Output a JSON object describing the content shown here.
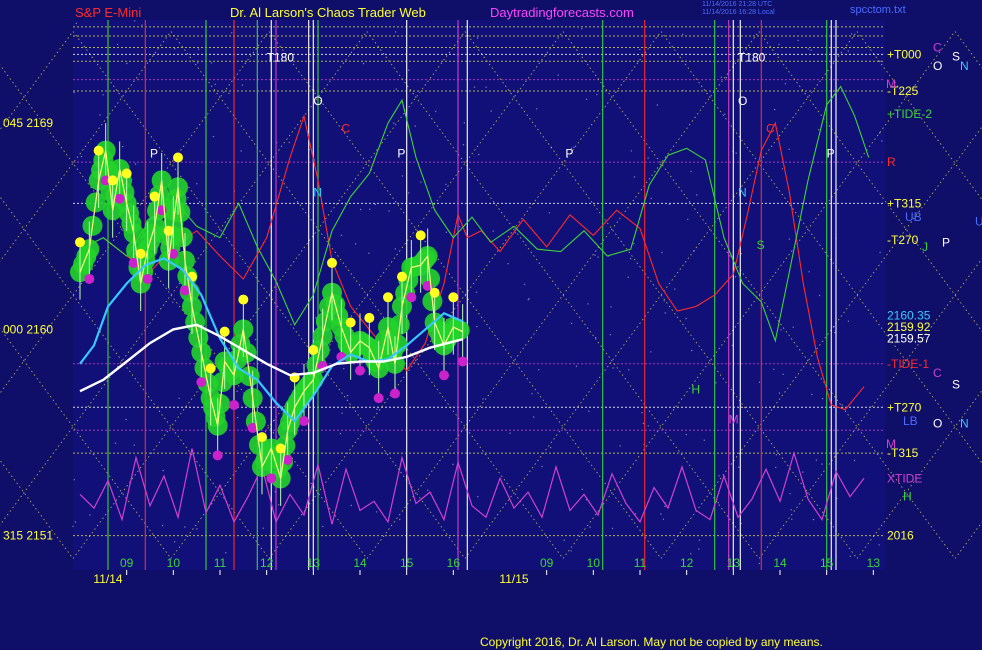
{
  "header": {
    "symbol": "S&P E-Mini",
    "site": "Dr. Al Larson's Chaos Trader Web",
    "url": "Daytradingforecasts.com",
    "utc_line1": "11/14/2016 21:28 UTC",
    "utc_line2": "11/14/2016 16:28 Local",
    "file": "spcctom.txt"
  },
  "footer": {
    "copyright": "Copyright 2016, Dr. Al Larson. May not be copied by any means."
  },
  "colors": {
    "background": "#0f0f6a",
    "grid_yellow": "#d8d84a",
    "price_green": "#22d42a",
    "price_yellow": "#ffff20",
    "price_magenta": "#cc22cc",
    "ma_cyan": "#38c8ff",
    "ma_white": "#ffffff",
    "forecast_red": "#ff2a2a",
    "forecast_green": "#3bd43b",
    "xtide_magenta": "#d040d0"
  },
  "chart_data": {
    "type": "line",
    "title": "S&P E-Mini",
    "y_axis_left": [
      {
        "label": "045  2169",
        "value": 2169
      },
      {
        "label": "000  2160",
        "value": 2160
      },
      {
        "label": "315  2151",
        "value": 2151
      }
    ],
    "ylim": [
      2149.5,
      2173.5
    ],
    "x_hour_labels": [
      {
        "label": "09",
        "h": 9
      },
      {
        "label": "10",
        "h": 10
      },
      {
        "label": "11",
        "h": 11
      },
      {
        "label": "12",
        "h": 12
      },
      {
        "label": "13",
        "h": 13
      },
      {
        "label": "14",
        "h": 14
      },
      {
        "label": "15",
        "h": 15
      },
      {
        "label": "16",
        "h": 16
      },
      {
        "label": "09",
        "h": 18
      },
      {
        "label": "10",
        "h": 19
      },
      {
        "label": "11",
        "h": 20
      },
      {
        "label": "12",
        "h": 21
      },
      {
        "label": "13",
        "h": 22
      },
      {
        "label": "14",
        "h": 23
      },
      {
        "label": "15",
        "h": 24
      },
      {
        "label": "13",
        "h": 25
      }
    ],
    "x_dates": [
      {
        "label": "11/14",
        "h": 8.6
      },
      {
        "label": "11/15",
        "h": 17.3
      }
    ],
    "right_labels": [
      {
        "label": "+T000",
        "value": 2172.0,
        "color": "#ffff40"
      },
      {
        "label": "-T225",
        "value": 2170.4,
        "color": "#ffff40"
      },
      {
        "label": "+TIDE-2",
        "value": 2169.4,
        "color": "#3bd43b"
      },
      {
        "label": "R",
        "value": 2167.3,
        "color": "#ff2a2a"
      },
      {
        "label": "+T315",
        "value": 2165.5,
        "color": "#ffff40"
      },
      {
        "label": "-T270",
        "value": 2163.9,
        "color": "#ffff40"
      },
      {
        "label": "2160.35",
        "value": 2160.6,
        "color": "#38c8ff"
      },
      {
        "label": "2159.92",
        "value": 2160.1,
        "color": "#ffff40"
      },
      {
        "label": "2159.57",
        "value": 2159.6,
        "color": "#ffffff"
      },
      {
        "label": "-TIDE-1",
        "value": 2158.5,
        "color": "#ff2a2a"
      },
      {
        "label": "+T270",
        "value": 2156.6,
        "color": "#ffff40"
      },
      {
        "label": "-T315",
        "value": 2154.6,
        "color": "#ffff40"
      },
      {
        "label": "XTIDE",
        "value": 2153.5,
        "color": "#d040d0"
      },
      {
        "label": "2016",
        "value": 2151.0,
        "color": "#ffff40"
      }
    ],
    "price_path": [
      [
        8.0,
        2162.5
      ],
      [
        8.2,
        2163.5
      ],
      [
        8.4,
        2166.5
      ],
      [
        8.55,
        2167.8
      ],
      [
        8.7,
        2165.2
      ],
      [
        8.85,
        2167.0
      ],
      [
        9.0,
        2165.5
      ],
      [
        9.15,
        2164.2
      ],
      [
        9.3,
        2162.0
      ],
      [
        9.45,
        2163.5
      ],
      [
        9.6,
        2164.5
      ],
      [
        9.75,
        2166.5
      ],
      [
        9.9,
        2163.0
      ],
      [
        10.0,
        2164.6
      ],
      [
        10.1,
        2166.2
      ],
      [
        10.25,
        2163.0
      ],
      [
        10.4,
        2161.0
      ],
      [
        10.6,
        2159.0
      ],
      [
        10.8,
        2157.0
      ],
      [
        10.95,
        2155.8
      ],
      [
        11.1,
        2158.6
      ],
      [
        11.3,
        2158.0
      ],
      [
        11.5,
        2160.0
      ],
      [
        11.7,
        2157.0
      ],
      [
        11.9,
        2154.0
      ],
      [
        12.1,
        2154.8
      ],
      [
        12.3,
        2153.5
      ],
      [
        12.45,
        2155.6
      ],
      [
        12.6,
        2156.6
      ],
      [
        12.8,
        2157.3
      ],
      [
        13.0,
        2157.8
      ],
      [
        13.2,
        2159.7
      ],
      [
        13.4,
        2161.6
      ],
      [
        13.6,
        2160.1
      ],
      [
        13.8,
        2159.0
      ],
      [
        14.0,
        2159.5
      ],
      [
        14.2,
        2159.2
      ],
      [
        14.4,
        2158.3
      ],
      [
        14.6,
        2160.1
      ],
      [
        14.75,
        2158.5
      ],
      [
        14.9,
        2161.0
      ],
      [
        15.1,
        2162.7
      ],
      [
        15.3,
        2162.8
      ],
      [
        15.45,
        2163.2
      ],
      [
        15.6,
        2160.3
      ],
      [
        15.8,
        2159.3
      ],
      [
        16.0,
        2160.1
      ],
      [
        16.2,
        2159.9
      ]
    ],
    "ma_cyan": [
      [
        8.0,
        2158.5
      ],
      [
        8.3,
        2159.3
      ],
      [
        8.6,
        2161.0
      ],
      [
        9.0,
        2162.0
      ],
      [
        9.4,
        2162.8
      ],
      [
        9.8,
        2163.1
      ],
      [
        10.2,
        2162.6
      ],
      [
        10.6,
        2161.5
      ],
      [
        11.0,
        2159.6
      ],
      [
        11.4,
        2158.3
      ],
      [
        11.8,
        2157.8
      ],
      [
        12.2,
        2156.8
      ],
      [
        12.6,
        2156.0
      ],
      [
        13.0,
        2157.1
      ],
      [
        13.4,
        2158.4
      ],
      [
        13.8,
        2158.9
      ],
      [
        14.2,
        2158.6
      ],
      [
        14.6,
        2158.7
      ],
      [
        15.0,
        2159.3
      ],
      [
        15.4,
        2160.0
      ],
      [
        15.8,
        2160.7
      ],
      [
        16.2,
        2160.35
      ]
    ],
    "ma_white": [
      [
        8.0,
        2157.3
      ],
      [
        8.5,
        2157.8
      ],
      [
        9.0,
        2158.6
      ],
      [
        9.5,
        2159.4
      ],
      [
        10.0,
        2160.0
      ],
      [
        10.5,
        2160.2
      ],
      [
        11.0,
        2159.7
      ],
      [
        11.5,
        2159.1
      ],
      [
        12.0,
        2158.5
      ],
      [
        12.5,
        2158.0
      ],
      [
        13.0,
        2158.1
      ],
      [
        13.5,
        2158.5
      ],
      [
        14.0,
        2158.6
      ],
      [
        14.5,
        2158.6
      ],
      [
        15.0,
        2158.8
      ],
      [
        15.5,
        2159.2
      ],
      [
        16.2,
        2159.57
      ]
    ],
    "forecast_red": [
      [
        8.5,
        2164.0
      ],
      [
        9.0,
        2163.2
      ],
      [
        9.5,
        2162.5
      ],
      [
        10.0,
        2163.6
      ],
      [
        10.5,
        2164.3
      ],
      [
        11.0,
        2163.2
      ],
      [
        11.5,
        2162.2
      ],
      [
        12.0,
        2164.0
      ],
      [
        12.5,
        2167.5
      ],
      [
        12.8,
        2169.3
      ],
      [
        13.1,
        2166.5
      ],
      [
        13.4,
        2163.0
      ],
      [
        13.8,
        2161.0
      ],
      [
        14.2,
        2160.0
      ],
      [
        14.6,
        2159.0
      ],
      [
        15.0,
        2158.2
      ],
      [
        15.4,
        2159.4
      ],
      [
        15.8,
        2162.0
      ],
      [
        16.1,
        2165.0
      ],
      [
        16.3,
        2164.0
      ],
      [
        16.6,
        2164.3
      ],
      [
        17.0,
        2163.4
      ],
      [
        17.5,
        2164.8
      ],
      [
        18.0,
        2163.6
      ],
      [
        18.5,
        2165.0
      ],
      [
        19.0,
        2164.1
      ],
      [
        19.5,
        2165.2
      ],
      [
        20.0,
        2164.4
      ],
      [
        20.4,
        2162.0
      ],
      [
        20.8,
        2160.8
      ],
      [
        21.2,
        2161.0
      ],
      [
        21.6,
        2161.5
      ],
      [
        22.0,
        2162.4
      ],
      [
        22.3,
        2165.0
      ],
      [
        22.6,
        2167.8
      ],
      [
        22.9,
        2169.0
      ],
      [
        23.2,
        2166.0
      ],
      [
        23.5,
        2162.0
      ],
      [
        23.8,
        2158.8
      ],
      [
        24.1,
        2156.7
      ],
      [
        24.4,
        2156.5
      ],
      [
        24.8,
        2157.5
      ]
    ],
    "forecast_green": [
      [
        8.0,
        2163.5
      ],
      [
        8.5,
        2164.0
      ],
      [
        9.0,
        2163.2
      ],
      [
        9.5,
        2164.8
      ],
      [
        10.0,
        2165.7
      ],
      [
        10.5,
        2164.5
      ],
      [
        11.0,
        2164.0
      ],
      [
        11.4,
        2165.5
      ],
      [
        11.8,
        2163.6
      ],
      [
        12.2,
        2162.1
      ],
      [
        12.6,
        2160.2
      ],
      [
        13.0,
        2161.5
      ],
      [
        13.4,
        2164.3
      ],
      [
        13.8,
        2165.8
      ],
      [
        14.2,
        2166.8
      ],
      [
        14.6,
        2169.0
      ],
      [
        14.9,
        2170.0
      ],
      [
        15.2,
        2167.5
      ],
      [
        15.6,
        2165.2
      ],
      [
        16.0,
        2164.0
      ],
      [
        16.4,
        2164.9
      ],
      [
        16.8,
        2163.8
      ],
      [
        17.3,
        2164.5
      ],
      [
        17.8,
        2163.5
      ],
      [
        18.3,
        2163.4
      ],
      [
        18.8,
        2164.3
      ],
      [
        19.3,
        2163.2
      ],
      [
        19.8,
        2163.5
      ],
      [
        20.2,
        2166.3
      ],
      [
        20.6,
        2167.6
      ],
      [
        21.0,
        2167.9
      ],
      [
        21.4,
        2167.4
      ],
      [
        21.8,
        2164.0
      ],
      [
        22.2,
        2162.0
      ],
      [
        22.6,
        2161.2
      ],
      [
        22.9,
        2159.5
      ],
      [
        23.2,
        2162.5
      ],
      [
        23.6,
        2166.5
      ],
      [
        24.0,
        2169.8
      ],
      [
        24.3,
        2170.6
      ],
      [
        24.6,
        2169.3
      ],
      [
        24.9,
        2167.5
      ]
    ],
    "xtide_magenta": [
      [
        8.0,
        2152.8
      ],
      [
        8.3,
        2152.2
      ],
      [
        8.6,
        2153.4
      ],
      [
        8.9,
        2151.7
      ],
      [
        9.2,
        2154.4
      ],
      [
        9.5,
        2152.3
      ],
      [
        9.8,
        2153.6
      ],
      [
        10.1,
        2151.8
      ],
      [
        10.4,
        2154.8
      ],
      [
        10.7,
        2152.0
      ],
      [
        11.0,
        2153.2
      ],
      [
        11.3,
        2151.6
      ],
      [
        11.6,
        2152.7
      ],
      [
        11.9,
        2154.0
      ],
      [
        12.2,
        2151.6
      ],
      [
        12.5,
        2152.8
      ],
      [
        12.8,
        2151.9
      ],
      [
        13.1,
        2154.1
      ],
      [
        13.4,
        2151.5
      ],
      [
        13.7,
        2153.9
      ],
      [
        14.0,
        2152.1
      ],
      [
        14.3,
        2152.5
      ],
      [
        14.6,
        2151.6
      ],
      [
        14.9,
        2154.4
      ],
      [
        15.2,
        2152.4
      ],
      [
        15.5,
        2152.9
      ],
      [
        15.8,
        2151.7
      ],
      [
        16.1,
        2154.2
      ],
      [
        16.4,
        2152.3
      ],
      [
        16.7,
        2151.8
      ],
      [
        17.0,
        2153.5
      ],
      [
        17.3,
        2152.2
      ],
      [
        17.6,
        2152.9
      ],
      [
        17.9,
        2151.8
      ],
      [
        18.2,
        2154.0
      ],
      [
        18.5,
        2152.1
      ],
      [
        18.8,
        2152.8
      ],
      [
        19.1,
        2151.9
      ],
      [
        19.4,
        2153.7
      ],
      [
        19.7,
        2152.4
      ],
      [
        20.0,
        2151.6
      ],
      [
        20.3,
        2153.1
      ],
      [
        20.6,
        2152.2
      ],
      [
        20.9,
        2154.0
      ],
      [
        21.2,
        2152.1
      ],
      [
        21.5,
        2151.7
      ],
      [
        21.8,
        2153.6
      ],
      [
        22.1,
        2151.8
      ],
      [
        22.4,
        2152.6
      ],
      [
        22.7,
        2153.9
      ],
      [
        23.0,
        2152.5
      ],
      [
        23.3,
        2154.6
      ],
      [
        23.6,
        2152.6
      ],
      [
        23.9,
        2151.7
      ],
      [
        24.2,
        2153.8
      ],
      [
        24.5,
        2152.7
      ],
      [
        24.8,
        2153.5
      ]
    ],
    "vertical_markers": [
      {
        "h": 8.6,
        "color": "#3bd43b"
      },
      {
        "h": 9.4,
        "color": "#ff2a2a"
      },
      {
        "h": 10.7,
        "color": "#3bd43b"
      },
      {
        "h": 11.3,
        "color": "#ff2a2a"
      },
      {
        "h": 11.8,
        "color": "#3bd43b"
      },
      {
        "h": 12.1,
        "color": "#ffffff"
      },
      {
        "h": 12.2,
        "color": "#d040d0"
      },
      {
        "h": 12.9,
        "color": "#ffffff"
      },
      {
        "h": 13.0,
        "color": "#ffffff"
      },
      {
        "h": 13.1,
        "color": "#3bd43b"
      },
      {
        "h": 15.0,
        "color": "#ffffff"
      },
      {
        "h": 16.1,
        "color": "#d040d0"
      },
      {
        "h": 16.3,
        "color": "#ffffff"
      },
      {
        "h": 19.2,
        "color": "#3bd43b"
      },
      {
        "h": 20.1,
        "color": "#ff2a2a"
      },
      {
        "h": 21.6,
        "color": "#3bd43b"
      },
      {
        "h": 21.9,
        "color": "#d040d0"
      },
      {
        "h": 22.0,
        "color": "#ffffff"
      },
      {
        "h": 22.15,
        "color": "#ffffff"
      },
      {
        "h": 22.6,
        "color": "#ff2a2a"
      },
      {
        "h": 24.0,
        "color": "#3bd43b"
      },
      {
        "h": 24.1,
        "color": "#ffffff"
      },
      {
        "h": 24.2,
        "color": "#ffffff"
      }
    ],
    "horizontal_levels": [
      {
        "value": 2173.2,
        "color": "#d8d84a"
      },
      {
        "value": 2172.8,
        "color": "#d8d84a"
      },
      {
        "value": 2172.3,
        "color": "#d8d84a"
      },
      {
        "value": 2172.0,
        "color": "#ffffff"
      },
      {
        "value": 2171.7,
        "color": "#d8d84a"
      },
      {
        "value": 2170.9,
        "color": "#d040d0"
      },
      {
        "value": 2170.4,
        "color": "#d8d84a"
      },
      {
        "value": 2167.3,
        "color": "#d040d0"
      },
      {
        "value": 2165.5,
        "color": "#ffffff"
      },
      {
        "value": 2158.5,
        "color": "#d040d0"
      },
      {
        "value": 2156.6,
        "color": "#ffffff"
      },
      {
        "value": 2155.6,
        "color": "#d040d0"
      },
      {
        "value": 2154.6,
        "color": "#d8d84a"
      },
      {
        "value": 2151.0,
        "color": "#d8d84a"
      }
    ],
    "annotations": [
      {
        "text": "T180",
        "h": 12.0,
        "v": 2171.7,
        "color": "#ffffff"
      },
      {
        "text": "T180",
        "h": 22.1,
        "v": 2171.7,
        "color": "#ffffff"
      },
      {
        "text": "O",
        "h": 13.0,
        "v": 2169.8,
        "color": "#ffffff"
      },
      {
        "text": "O",
        "h": 22.1,
        "v": 2169.8,
        "color": "#ffffff"
      },
      {
        "text": "C",
        "h": 13.6,
        "v": 2168.6,
        "color": "#ff2a2a"
      },
      {
        "text": "C",
        "h": 22.7,
        "v": 2168.6,
        "color": "#ff2a2a"
      },
      {
        "text": "P",
        "h": 9.5,
        "v": 2167.5,
        "color": "#ffffff"
      },
      {
        "text": "P",
        "h": 14.8,
        "v": 2167.5,
        "color": "#ffffff"
      },
      {
        "text": "P",
        "h": 18.4,
        "v": 2167.5,
        "color": "#ffffff"
      },
      {
        "text": "P",
        "h": 24.0,
        "v": 2167.5,
        "color": "#ffffff"
      },
      {
        "text": "N",
        "h": 13.0,
        "v": 2165.8,
        "color": "#38c8ff"
      },
      {
        "text": "N",
        "h": 22.1,
        "v": 2165.8,
        "color": "#38c8ff"
      },
      {
        "text": "H",
        "h": 21.1,
        "v": 2157.2,
        "color": "#3bd43b"
      },
      {
        "text": "M",
        "h": 21.9,
        "v": 2155.9,
        "color": "#d040d0"
      },
      {
        "text": "S",
        "h": 22.5,
        "v": 2163.5,
        "color": "#3bd43b"
      }
    ],
    "right_glyphs": [
      {
        "text": "C",
        "v": 2172.3,
        "x": 933,
        "color": "#d040d0"
      },
      {
        "text": "S",
        "v": 2171.9,
        "x": 952,
        "color": "#ffffff"
      },
      {
        "text": "O",
        "v": 2171.5,
        "x": 933,
        "color": "#ffffff"
      },
      {
        "text": "N",
        "v": 2171.5,
        "x": 960,
        "color": "#38c8ff"
      },
      {
        "text": "M",
        "v": 2170.7,
        "x": 886,
        "color": "#d040d0"
      },
      {
        "text": "U",
        "v": 2164.7,
        "x": 975,
        "color": "#4a6cff"
      },
      {
        "text": "UB",
        "v": 2164.9,
        "x": 905,
        "color": "#4a6cff"
      },
      {
        "text": "J",
        "v": 2163.6,
        "x": 922,
        "color": "#3bd43b"
      },
      {
        "text": "P",
        "v": 2163.8,
        "x": 942,
        "color": "#ffffff"
      },
      {
        "text": "C",
        "v": 2158.1,
        "x": 933,
        "color": "#d040d0"
      },
      {
        "text": "S",
        "v": 2157.6,
        "x": 952,
        "color": "#ffffff"
      },
      {
        "text": "LB",
        "v": 2156.0,
        "x": 903,
        "color": "#4a6cff"
      },
      {
        "text": "O",
        "v": 2155.9,
        "x": 933,
        "color": "#ffffff"
      },
      {
        "text": "N",
        "v": 2155.9,
        "x": 960,
        "color": "#38c8ff"
      },
      {
        "text": "M",
        "v": 2155.0,
        "x": 886,
        "color": "#d040d0"
      },
      {
        "text": "H",
        "v": 2152.7,
        "x": 903,
        "color": "#3bd43b"
      }
    ]
  }
}
